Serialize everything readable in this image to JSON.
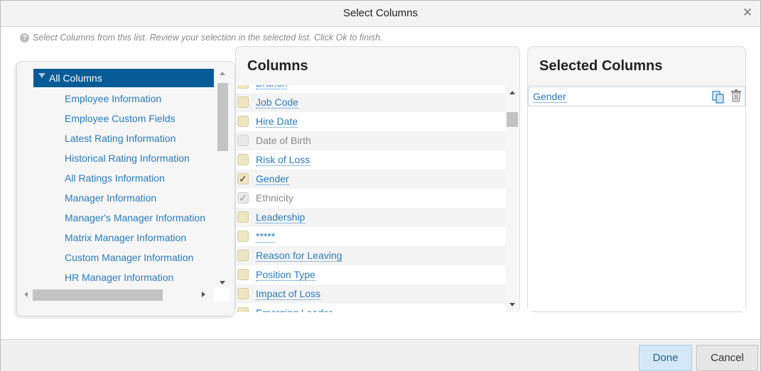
{
  "dialog": {
    "title": "Select Columns"
  },
  "instruction": "Select Columns from this list. Review your selection in the selected list. Click Ok to finish.",
  "tree": {
    "root": "All Columns",
    "items": [
      "Employee Information",
      "Employee Custom Fields",
      "Latest Rating Information",
      "Historical Rating Information",
      "All Ratings Information",
      "Manager Information",
      "Manager's Manager Information",
      "Matrix Manager Information",
      "Custom Manager Information",
      "HR Manager Information"
    ]
  },
  "columns": {
    "title": "Columns",
    "rows": [
      {
        "label": "Branch",
        "checked": false,
        "disabled": false
      },
      {
        "label": "Job Code",
        "checked": false,
        "disabled": false
      },
      {
        "label": "Hire Date",
        "checked": false,
        "disabled": false
      },
      {
        "label": "Date of Birth",
        "checked": false,
        "disabled": true
      },
      {
        "label": "Risk of Loss",
        "checked": false,
        "disabled": false
      },
      {
        "label": "Gender",
        "checked": true,
        "disabled": false
      },
      {
        "label": "Ethnicity",
        "checked": true,
        "disabled": true
      },
      {
        "label": "Leadership",
        "checked": false,
        "disabled": false
      },
      {
        "label": "*****",
        "checked": false,
        "disabled": false
      },
      {
        "label": "Reason for Leaving",
        "checked": false,
        "disabled": false
      },
      {
        "label": "Position Type",
        "checked": false,
        "disabled": false
      },
      {
        "label": "Impact of Loss",
        "checked": false,
        "disabled": false
      },
      {
        "label": "Emerging Leader",
        "checked": false,
        "disabled": false
      }
    ]
  },
  "selected": {
    "title": "Selected Columns",
    "items": [
      {
        "label": "Gender"
      }
    ]
  },
  "footer": {
    "done_label": "Done",
    "cancel_label": "Cancel"
  },
  "icons": {
    "close": "close-icon",
    "help": "help-icon",
    "copy": "copy-icon",
    "delete": "trash-icon"
  },
  "colors": {
    "accent": "#045b95",
    "link": "#2a7bbd",
    "checkbox": "#efe6bf"
  }
}
